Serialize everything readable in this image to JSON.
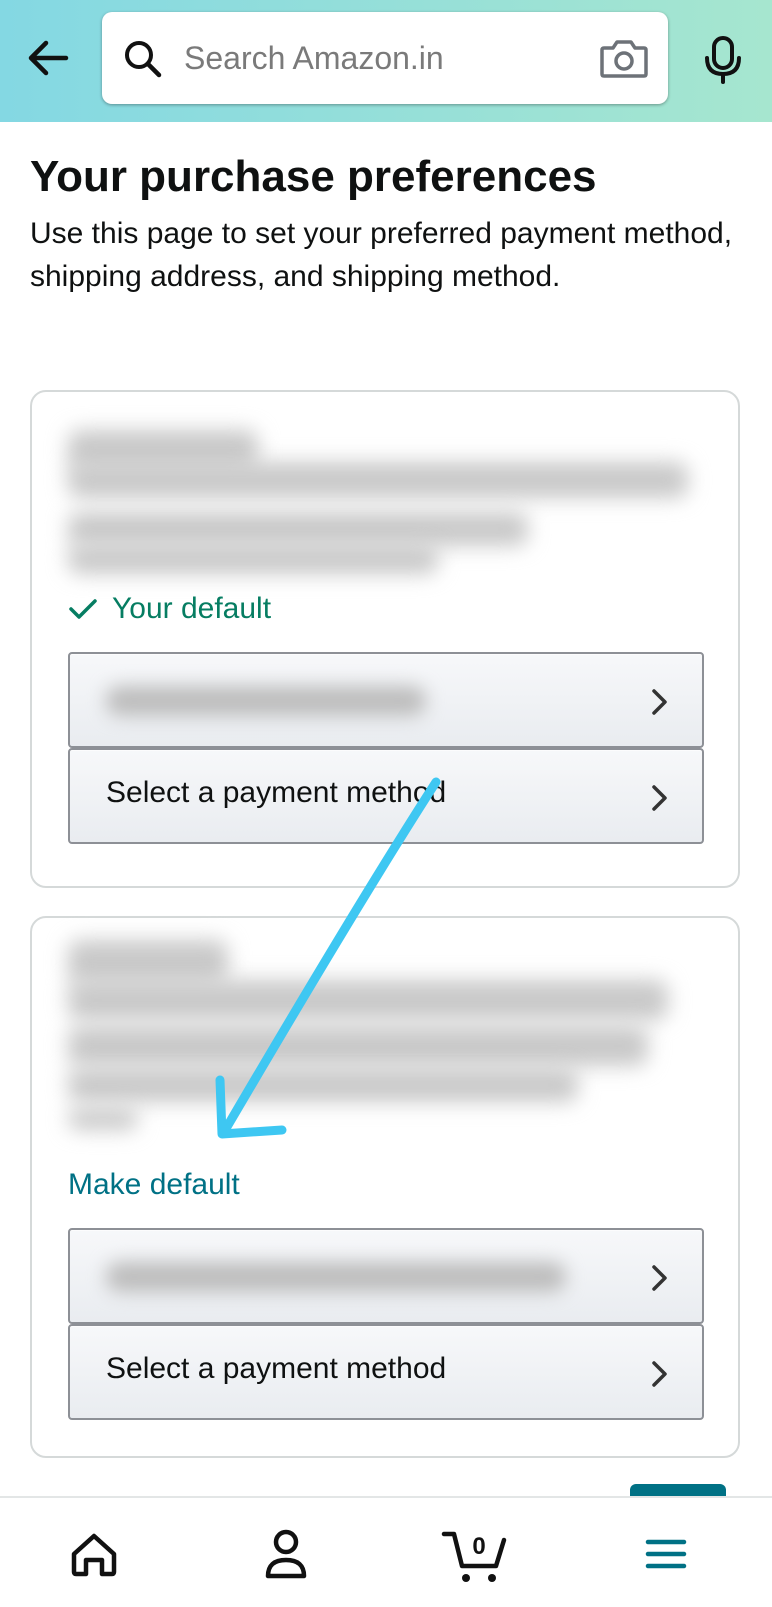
{
  "header": {
    "search_placeholder": "Search Amazon.in",
    "icons": {
      "back": "back-arrow-icon",
      "search": "search-icon",
      "camera": "camera-icon",
      "mic": "microphone-icon"
    }
  },
  "page": {
    "title": "Your purchase preferences",
    "description": "Use this page to set your preferred payment method, shipping address, and shipping method."
  },
  "addresses": [
    {
      "status_label": "Your default",
      "payment_label": "Select a payment method"
    },
    {
      "action_label": "Make default",
      "payment_label": "Select a payment method"
    }
  ],
  "bottom_nav": {
    "items": [
      "home-icon",
      "account-icon",
      "cart-icon",
      "menu-icon"
    ],
    "cart_count": "0",
    "active": "menu"
  },
  "colors": {
    "link": "#007185",
    "success": "#067d62",
    "annotation": "#3ec7f2"
  }
}
